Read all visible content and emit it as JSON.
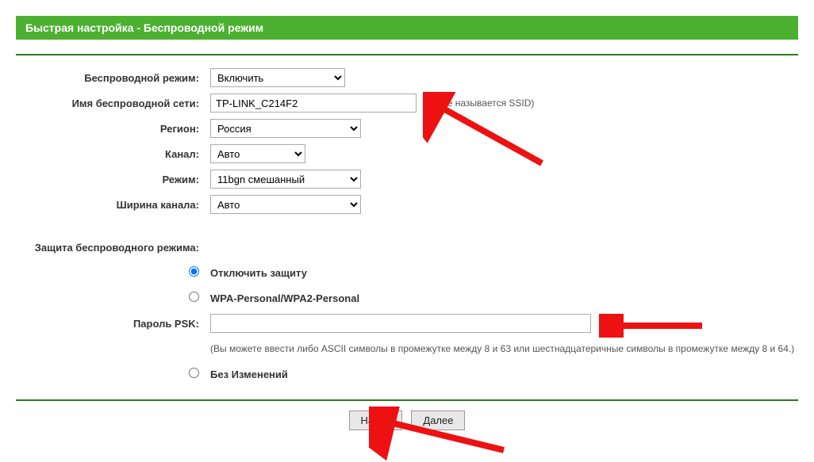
{
  "header": "Быстрая настройка - Беспроводной режим",
  "labels": {
    "wireless_mode": "Беспроводной режим:",
    "ssid": "Имя беспроводной сети:",
    "region": "Регион:",
    "channel": "Канал:",
    "mode": "Режим:",
    "width": "Ширина канала:",
    "security": "Защита беспроводного режима:",
    "psk_password": "Пароль PSK:"
  },
  "fields": {
    "wireless_mode": "Включить",
    "ssid": "TP-LINK_C214F2",
    "ssid_hint": "(Также называется SSID)",
    "region": "Россия",
    "channel": "Авто",
    "mode": "11bgn смешанный",
    "width": "Авто",
    "psk": ""
  },
  "security_options": {
    "disable": "Отключить защиту",
    "wpa": "WPA-Personal/WPA2-Personal",
    "no_change": "Без Изменений"
  },
  "psk_hint": "(Вы можете ввести либо ASCII символы в промежутке между 8 и 63 или шестнадцатеричные символы в промежутке между 8 и 64.)",
  "buttons": {
    "back": "Назад",
    "next": "Далее"
  }
}
